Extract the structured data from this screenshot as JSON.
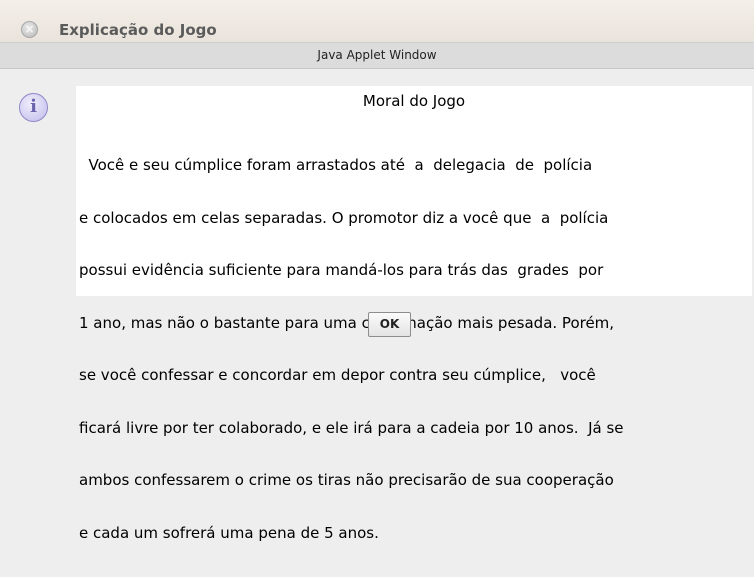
{
  "window": {
    "title": "Explicação do Jogo",
    "close_glyph": "×"
  },
  "applet_bar": {
    "label": "Java Applet Window"
  },
  "dialog": {
    "icon": "info-icon",
    "icon_glyph": "i",
    "heading": "Moral do Jogo",
    "body_lines": [
      "  Você e seu cúmplice foram arrastados até  a  delegacia  de  polícia",
      "e colocados em celas separadas. O promotor diz a você que  a  polícia",
      "possui evidência suficiente para mandá-los para trás das  grades  por",
      "1 ano, mas não o bastante para uma condenação mais pesada. Porém,",
      "se você confessar e concordar em depor contra seu cúmplice,   você",
      "ficará livre por ter colaborado, e ele irá para a cadeia por 10 anos.  Já se",
      "ambos confessarem o crime os tiras não precisarão de sua cooperação",
      "e cada um sofrerá uma pena de 5 anos."
    ],
    "ok_label": "OK"
  }
}
